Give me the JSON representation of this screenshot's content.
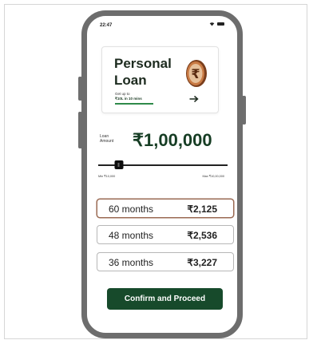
{
  "status_bar": {
    "time": "22:47"
  },
  "loan_card": {
    "title": "Personal Loan",
    "subtitle_line1": "Get up to",
    "subtitle_line2": "₹10L in 10 mins"
  },
  "amount": {
    "label": "Loan Amount",
    "value": "₹1,00,000"
  },
  "slider": {
    "position_percent": 16,
    "min_label": "Min ₹10,000",
    "max_label": "Max ₹10,00,000"
  },
  "plans": [
    {
      "months": "60 months",
      "emi": "₹2,125",
      "selected": true
    },
    {
      "months": "48 months",
      "emi": "₹2,536",
      "selected": false
    },
    {
      "months": "36 months",
      "emi": "₹3,227",
      "selected": false
    }
  ],
  "confirm_label": "Confirm and Proceed",
  "colors": {
    "brand_green": "#174a2b",
    "selected_border": "#9a6a53",
    "coin": "#b86a3a"
  },
  "icons": {
    "coin": "rupee-coin-icon",
    "arrow": "arrow-right-icon",
    "wifi": "wifi-icon",
    "battery": "battery-icon"
  }
}
